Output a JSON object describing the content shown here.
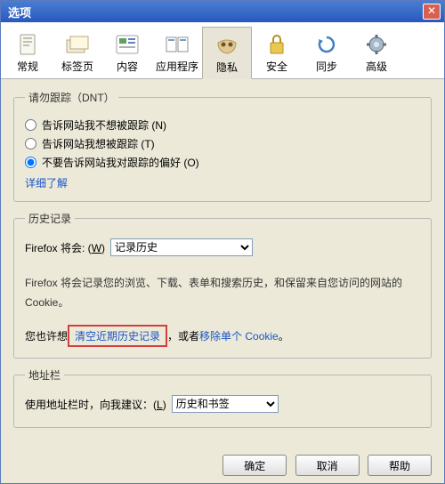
{
  "window": {
    "title": "选项"
  },
  "tabs": {
    "general": "常规",
    "tabpages": "标签页",
    "content": "内容",
    "apps": "应用程序",
    "privacy": "隐私",
    "security": "安全",
    "sync": "同步",
    "advanced": "高级"
  },
  "dnt": {
    "legend": "请勿跟踪（DNT）",
    "opt1": "告诉网站我不想被跟踪 (N)",
    "opt2": "告诉网站我想被跟踪 (T)",
    "opt3": "不要告诉网站我对跟踪的偏好 (O)",
    "learn": "详细了解"
  },
  "history": {
    "legend": "历史记录",
    "label_prefix": "Firefox 将会: (",
    "label_accel": "W",
    "label_suffix": ")",
    "select_value": "记录历史",
    "info": "Firefox 将会记录您的浏览、下载、表单和搜索历史，和保留来自您访问的网站的 Cookie。",
    "you_may_prefix": "您也许想",
    "clear_link": "清空近期历史记录",
    "you_may_middle": "，或者",
    "remove_link": "移除单个 Cookie",
    "you_may_suffix": "。"
  },
  "locbar": {
    "legend": "地址栏",
    "label_prefix": "使用地址栏时，向我建议：(",
    "label_accel": "L",
    "label_suffix": ")",
    "select_value": "历史和书签"
  },
  "buttons": {
    "ok": "确定",
    "cancel": "取消",
    "help": "帮助"
  }
}
